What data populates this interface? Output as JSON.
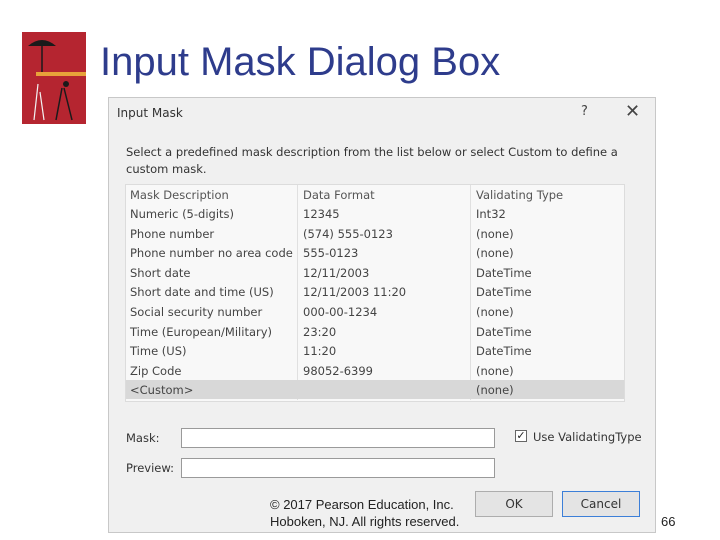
{
  "slide": {
    "title": "Input Mask Dialog Box",
    "copyright_line1": "© 2017 Pearson Education, Inc.",
    "copyright_line2": "Hoboken, NJ. All rights reserved.",
    "page_number": "66"
  },
  "dialog": {
    "title": "Input Mask",
    "help": "?",
    "close": "✕",
    "instruction": "Select a predefined mask description from the list below or select Custom to define a custom mask.",
    "columns": [
      "Mask Description",
      "Data Format",
      "Validating Type"
    ],
    "rows": [
      [
        "Numeric (5-digits)",
        "12345",
        "Int32"
      ],
      [
        "Phone number",
        "(574) 555-0123",
        "(none)"
      ],
      [
        "Phone number no area code",
        "555-0123",
        "(none)"
      ],
      [
        "Short date",
        "12/11/2003",
        "DateTime"
      ],
      [
        "Short date and time (US)",
        "12/11/2003 11:20",
        "DateTime"
      ],
      [
        "Social security number",
        "000-00-1234",
        "(none)"
      ],
      [
        "Time (European/Military)",
        "23:20",
        "DateTime"
      ],
      [
        "Time (US)",
        "11:20",
        "DateTime"
      ],
      [
        "Zip Code",
        "98052-6399",
        "(none)"
      ],
      [
        "<Custom>",
        "",
        "(none)"
      ]
    ],
    "selected_row": 9,
    "mask_label": "Mask:",
    "mask_value": "",
    "preview_label": "Preview:",
    "preview_value": "",
    "use_validating_type_label": "Use ValidatingType",
    "use_validating_type_checked": true,
    "ok_label": "OK",
    "cancel_label": "Cancel"
  }
}
